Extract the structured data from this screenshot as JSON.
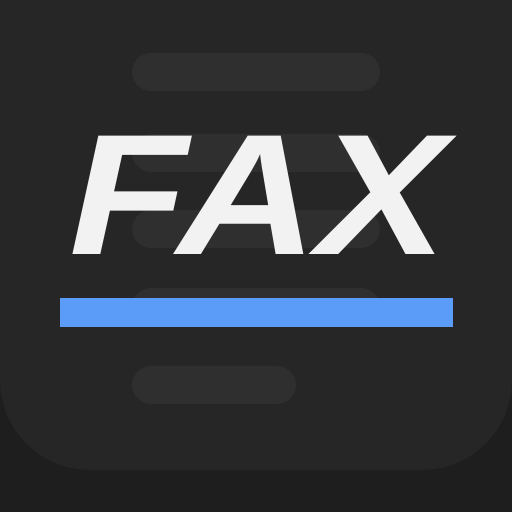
{
  "app_icon": {
    "wordmark": "FAX",
    "colors": {
      "background": "#1e1e1e",
      "tile": "#262626",
      "placeholder_lines": "#2f2f2f",
      "wordmark": "#f2f2f2",
      "accent_underline": "#5b9cf8"
    }
  }
}
